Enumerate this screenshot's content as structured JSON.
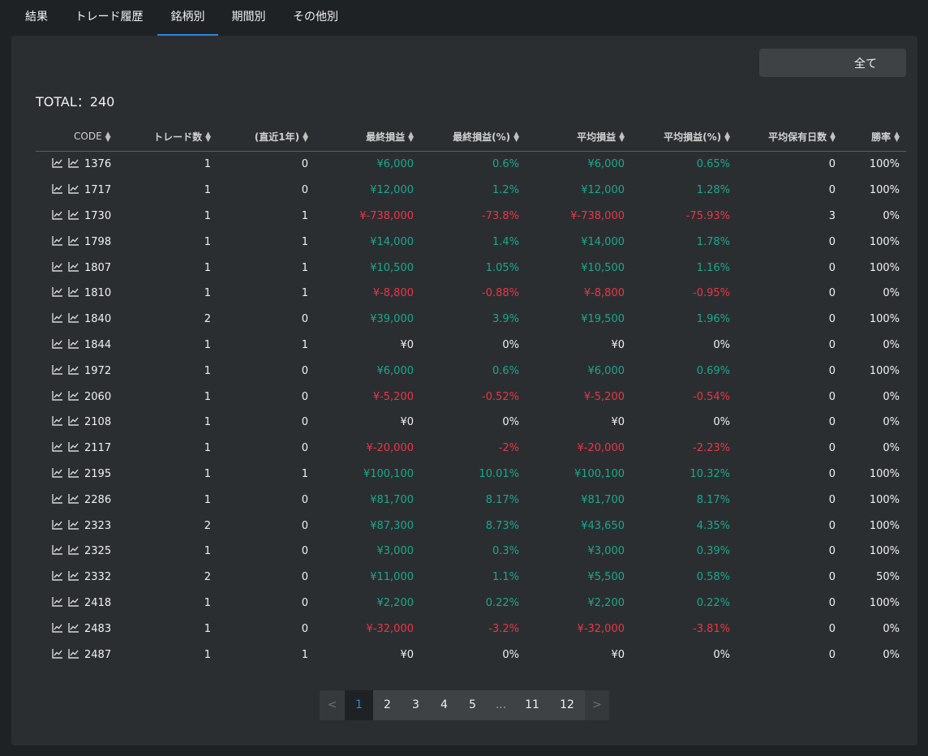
{
  "tabs": [
    {
      "label": "結果"
    },
    {
      "label": "トレード履歴"
    },
    {
      "label": "銘柄別"
    },
    {
      "label": "期間別"
    },
    {
      "label": "その他別"
    }
  ],
  "active_tab": 2,
  "filter_button_label": "全て",
  "total_label": "TOTAL：240",
  "columns": [
    "CODE",
    "トレード数",
    "(直近1年)",
    "最終損益",
    "最終損益(%)",
    "平均損益",
    "平均損益(%)",
    "平均保有日数",
    "勝率"
  ],
  "rows": [
    {
      "code": "1376",
      "trades": "1",
      "recent": "0",
      "final": "¥6,000",
      "final_pct": "0.6%",
      "avg": "¥6,000",
      "avg_pct": "0.65%",
      "days": "0",
      "win": "100%",
      "sign": "pos"
    },
    {
      "code": "1717",
      "trades": "1",
      "recent": "0",
      "final": "¥12,000",
      "final_pct": "1.2%",
      "avg": "¥12,000",
      "avg_pct": "1.28%",
      "days": "0",
      "win": "100%",
      "sign": "pos"
    },
    {
      "code": "1730",
      "trades": "1",
      "recent": "1",
      "final": "¥-738,000",
      "final_pct": "-73.8%",
      "avg": "¥-738,000",
      "avg_pct": "-75.93%",
      "days": "3",
      "win": "0%",
      "sign": "neg"
    },
    {
      "code": "1798",
      "trades": "1",
      "recent": "1",
      "final": "¥14,000",
      "final_pct": "1.4%",
      "avg": "¥14,000",
      "avg_pct": "1.78%",
      "days": "0",
      "win": "100%",
      "sign": "pos"
    },
    {
      "code": "1807",
      "trades": "1",
      "recent": "1",
      "final": "¥10,500",
      "final_pct": "1.05%",
      "avg": "¥10,500",
      "avg_pct": "1.16%",
      "days": "0",
      "win": "100%",
      "sign": "pos"
    },
    {
      "code": "1810",
      "trades": "1",
      "recent": "1",
      "final": "¥-8,800",
      "final_pct": "-0.88%",
      "avg": "¥-8,800",
      "avg_pct": "-0.95%",
      "days": "0",
      "win": "0%",
      "sign": "neg"
    },
    {
      "code": "1840",
      "trades": "2",
      "recent": "0",
      "final": "¥39,000",
      "final_pct": "3.9%",
      "avg": "¥19,500",
      "avg_pct": "1.96%",
      "days": "0",
      "win": "100%",
      "sign": "pos"
    },
    {
      "code": "1844",
      "trades": "1",
      "recent": "1",
      "final": "¥0",
      "final_pct": "0%",
      "avg": "¥0",
      "avg_pct": "0%",
      "days": "0",
      "win": "0%",
      "sign": "zero"
    },
    {
      "code": "1972",
      "trades": "1",
      "recent": "0",
      "final": "¥6,000",
      "final_pct": "0.6%",
      "avg": "¥6,000",
      "avg_pct": "0.69%",
      "days": "0",
      "win": "100%",
      "sign": "pos"
    },
    {
      "code": "2060",
      "trades": "1",
      "recent": "0",
      "final": "¥-5,200",
      "final_pct": "-0.52%",
      "avg": "¥-5,200",
      "avg_pct": "-0.54%",
      "days": "0",
      "win": "0%",
      "sign": "neg"
    },
    {
      "code": "2108",
      "trades": "1",
      "recent": "0",
      "final": "¥0",
      "final_pct": "0%",
      "avg": "¥0",
      "avg_pct": "0%",
      "days": "0",
      "win": "0%",
      "sign": "zero"
    },
    {
      "code": "2117",
      "trades": "1",
      "recent": "0",
      "final": "¥-20,000",
      "final_pct": "-2%",
      "avg": "¥-20,000",
      "avg_pct": "-2.23%",
      "days": "0",
      "win": "0%",
      "sign": "neg"
    },
    {
      "code": "2195",
      "trades": "1",
      "recent": "1",
      "final": "¥100,100",
      "final_pct": "10.01%",
      "avg": "¥100,100",
      "avg_pct": "10.32%",
      "days": "0",
      "win": "100%",
      "sign": "pos"
    },
    {
      "code": "2286",
      "trades": "1",
      "recent": "0",
      "final": "¥81,700",
      "final_pct": "8.17%",
      "avg": "¥81,700",
      "avg_pct": "8.17%",
      "days": "0",
      "win": "100%",
      "sign": "pos"
    },
    {
      "code": "2323",
      "trades": "2",
      "recent": "0",
      "final": "¥87,300",
      "final_pct": "8.73%",
      "avg": "¥43,650",
      "avg_pct": "4.35%",
      "days": "0",
      "win": "100%",
      "sign": "pos"
    },
    {
      "code": "2325",
      "trades": "1",
      "recent": "0",
      "final": "¥3,000",
      "final_pct": "0.3%",
      "avg": "¥3,000",
      "avg_pct": "0.39%",
      "days": "0",
      "win": "100%",
      "sign": "pos"
    },
    {
      "code": "2332",
      "trades": "2",
      "recent": "0",
      "final": "¥11,000",
      "final_pct": "1.1%",
      "avg": "¥5,500",
      "avg_pct": "0.58%",
      "days": "0",
      "win": "50%",
      "sign": "pos"
    },
    {
      "code": "2418",
      "trades": "1",
      "recent": "0",
      "final": "¥2,200",
      "final_pct": "0.22%",
      "avg": "¥2,200",
      "avg_pct": "0.22%",
      "days": "0",
      "win": "100%",
      "sign": "pos"
    },
    {
      "code": "2483",
      "trades": "1",
      "recent": "0",
      "final": "¥-32,000",
      "final_pct": "-3.2%",
      "avg": "¥-32,000",
      "avg_pct": "-3.81%",
      "days": "0",
      "win": "0%",
      "sign": "neg"
    },
    {
      "code": "2487",
      "trades": "1",
      "recent": "1",
      "final": "¥0",
      "final_pct": "0%",
      "avg": "¥0",
      "avg_pct": "0%",
      "days": "0",
      "win": "0%",
      "sign": "zero"
    }
  ],
  "pagination": {
    "prev": "<",
    "next": ">",
    "pages": [
      "1",
      "2",
      "3",
      "4",
      "5",
      "...",
      "11",
      "12"
    ],
    "current": "1"
  },
  "colors": {
    "positive": "#1aa88e",
    "negative": "#e8364a",
    "accent": "#2e86de"
  }
}
